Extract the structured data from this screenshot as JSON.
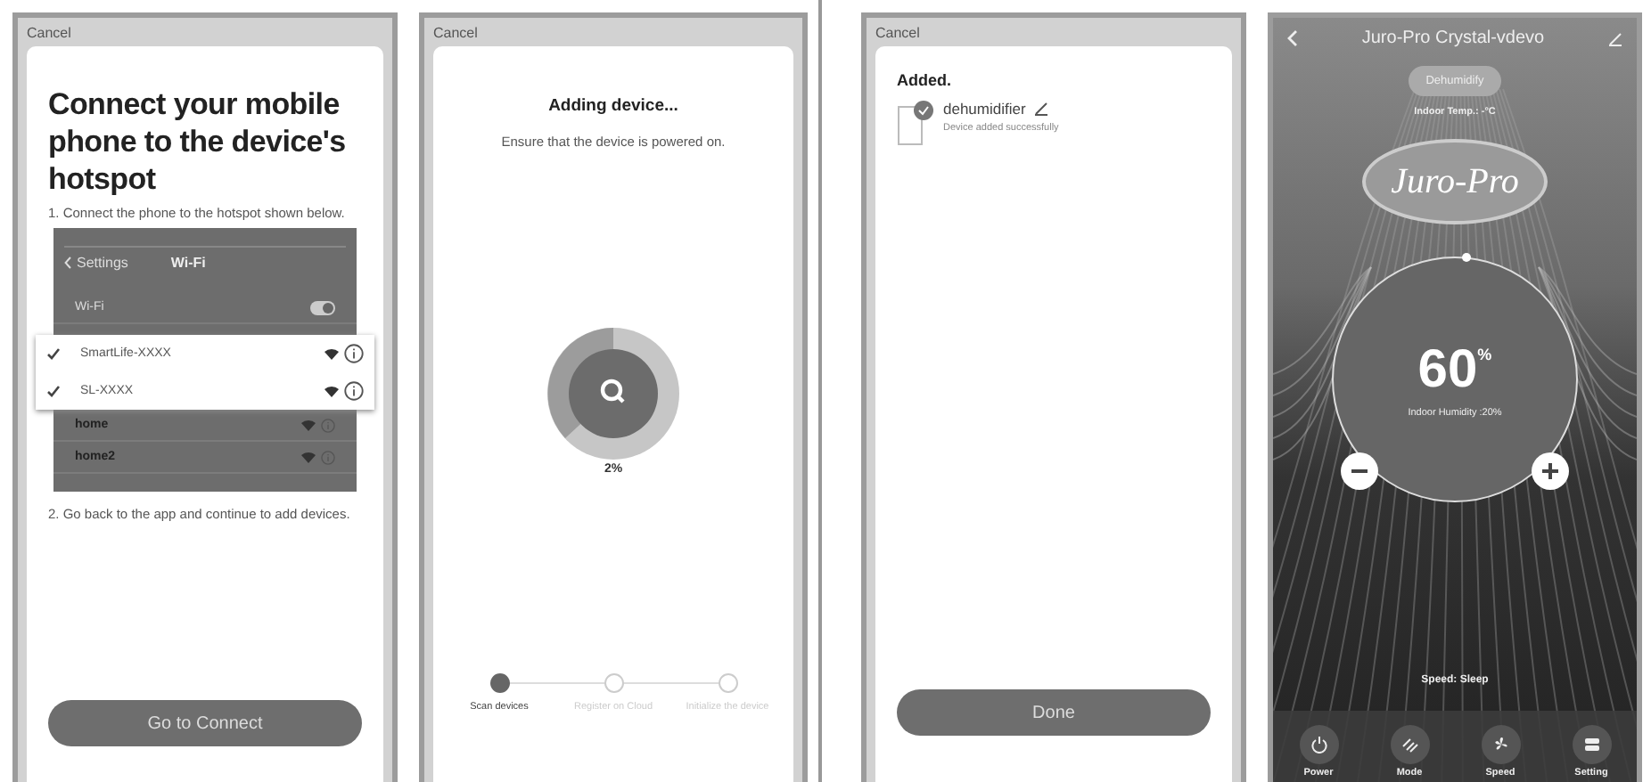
{
  "screens": [
    {
      "kind": "hotspot",
      "cancel": "Cancel",
      "title": "Connect your mobile phone to the device's hotspot",
      "step_1": "1. Connect the phone to the hotspot shown below.",
      "wifi_settings": {
        "back": "Settings",
        "title": "Wi-Fi",
        "wifi_label": "Wi-Fi",
        "wifi_on": true,
        "highlighted": [
          {
            "name": "SmartLife-XXXX"
          },
          {
            "name": "SL-XXXX"
          }
        ],
        "networks": [
          {
            "name": "home"
          },
          {
            "name": "home2"
          }
        ]
      },
      "step_2": "2. Go back to the app and continue to add devices.",
      "button": "Go to Connect"
    },
    {
      "kind": "adding",
      "cancel": "Cancel",
      "title": "Adding device...",
      "subtitle": "Ensure that the device is powered on.",
      "percent": "2%",
      "steps": [
        {
          "label": "Scan devices",
          "selected": true
        },
        {
          "label": "Register on Cloud",
          "selected": false
        },
        {
          "label": "Initialize the device",
          "selected": false
        }
      ]
    },
    {
      "kind": "added",
      "cancel": "Cancel",
      "title": "Added.",
      "device_name": "dehumidifier",
      "device_status": "Device added successfully",
      "button": "Done"
    },
    {
      "kind": "control",
      "title": "Juro-Pro Crystal-vdevo",
      "mode": "Dehumidify",
      "indoor_temp": "Indoor Temp.: -°C",
      "logo": "Juro-Pro",
      "humidity": "60",
      "humidity_unit": "%",
      "indoor_humidity": "Indoor Humidity :20%",
      "speed": "Speed: Sleep",
      "actions": [
        {
          "label": "Power",
          "kind": "power"
        },
        {
          "label": "Mode",
          "kind": "mode"
        },
        {
          "label": "Speed",
          "kind": "speed"
        },
        {
          "label": "Setting",
          "kind": "setting"
        }
      ]
    }
  ]
}
